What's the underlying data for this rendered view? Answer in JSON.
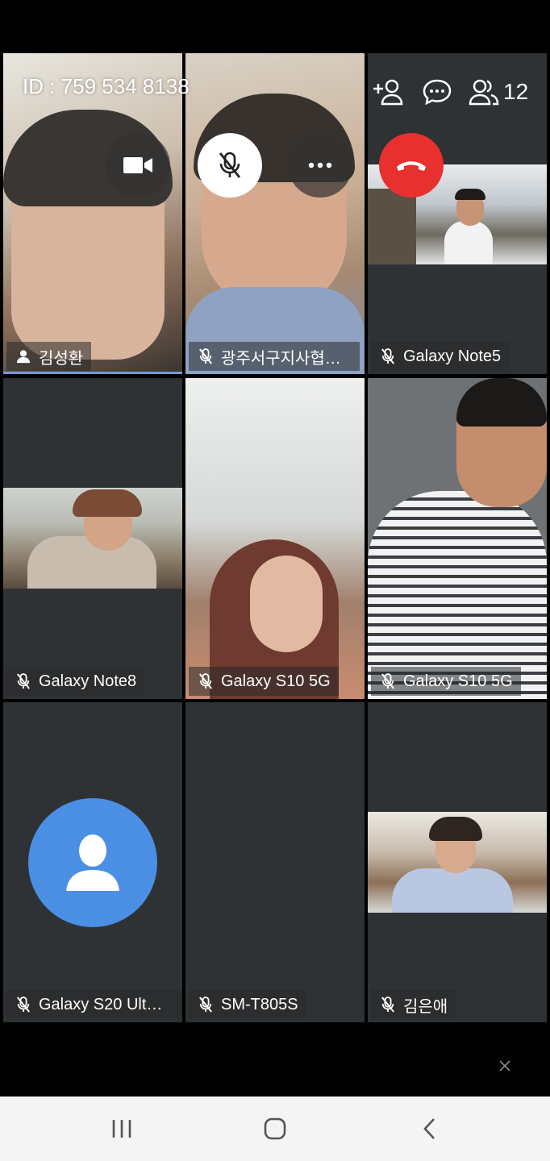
{
  "meeting": {
    "id_text": "ID : 759 534 8138",
    "participant_count": "12"
  },
  "controls": {
    "camera_icon": "video-camera-icon",
    "mute_icon": "mic-off-icon",
    "more_icon": "more-horizontal-icon",
    "hangup_icon": "phone-hangup-icon",
    "add_person_icon": "add-person-icon",
    "chat_icon": "chat-bubble-icon",
    "participants_icon": "people-icon"
  },
  "participants": [
    {
      "name": "김성환",
      "icon": "person-icon"
    },
    {
      "name": "광주서구지사협…",
      "icon": "mic-off-icon"
    },
    {
      "name": "Galaxy Note5",
      "icon": "mic-off-icon"
    },
    {
      "name": "Galaxy Note8",
      "icon": "mic-off-icon"
    },
    {
      "name": "Galaxy S10 5G",
      "icon": "mic-off-icon"
    },
    {
      "name": "Galaxy S10 5G",
      "icon": "mic-off-icon"
    },
    {
      "name": "Galaxy S20 Ult…",
      "icon": "mic-off-icon"
    },
    {
      "name": "SM-T805S",
      "icon": "mic-off-icon"
    },
    {
      "name": "김은애",
      "icon": "mic-off-icon"
    }
  ],
  "colors": {
    "hangup": "#e8302e",
    "avatar": "#4a8fe4",
    "tile_bg": "#2f3234",
    "navbar_bg": "#f4f4f4"
  },
  "navbar": {
    "recents_icon": "recents-icon",
    "home_icon": "home-icon",
    "back_icon": "back-icon"
  }
}
